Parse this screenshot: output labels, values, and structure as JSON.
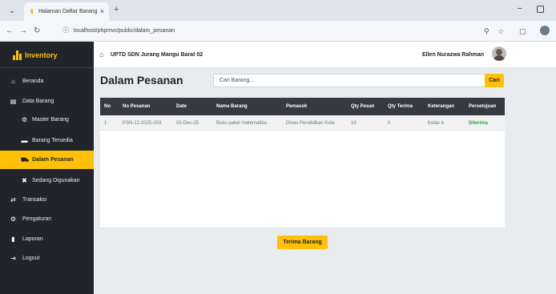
{
  "browser": {
    "tab_title": "Halaman Daftar Barang",
    "url": "localhost/phpmvc/public/dalam_pesanan"
  },
  "sidebar": {
    "brand": "Inventory",
    "items": [
      {
        "label": "Beranda",
        "icon": "home-icon"
      },
      {
        "label": "Data Barang",
        "icon": "database-icon"
      },
      {
        "label": "Master Barang",
        "icon": "gear-icon"
      },
      {
        "label": "Barang Tersedia",
        "icon": "boxes-icon"
      },
      {
        "label": "Dalam Pesanan",
        "icon": "cart-icon",
        "active": true
      },
      {
        "label": "Sedang Digunakan",
        "icon": "tools-icon"
      },
      {
        "label": "Transaksi",
        "icon": "exchange-icon"
      },
      {
        "label": "Pengaturan",
        "icon": "gears-icon"
      },
      {
        "label": "Laporan",
        "icon": "file-icon"
      },
      {
        "label": "Logout",
        "icon": "logout-icon"
      }
    ]
  },
  "header": {
    "school": "UPTD SDN Jurang Mangu Barat 02",
    "user": "Ellen Nurazwa Rahman"
  },
  "main": {
    "title": "Dalam Pesanan",
    "search_placeholder": "Cari Barang...",
    "search_button": "Cari",
    "columns": [
      "No",
      "No Pesanan",
      "Date",
      "Nama Barang",
      "Pemasok",
      "Qty Pesan",
      "Qty Terima",
      "Keterangan",
      "Persetujuan"
    ],
    "rows": [
      [
        "1",
        "PSN-12-2025-003",
        "02-Dec-25",
        "Buku paket matematika",
        "Dinas Pendidikan Kota",
        "10",
        "0",
        "Kelas 6",
        "Diterima"
      ]
    ],
    "receive_button": "Terima Barang"
  },
  "colors": {
    "accent": "#ffc107",
    "sidebar_bg": "#212529",
    "status_ok": "#28a745"
  }
}
